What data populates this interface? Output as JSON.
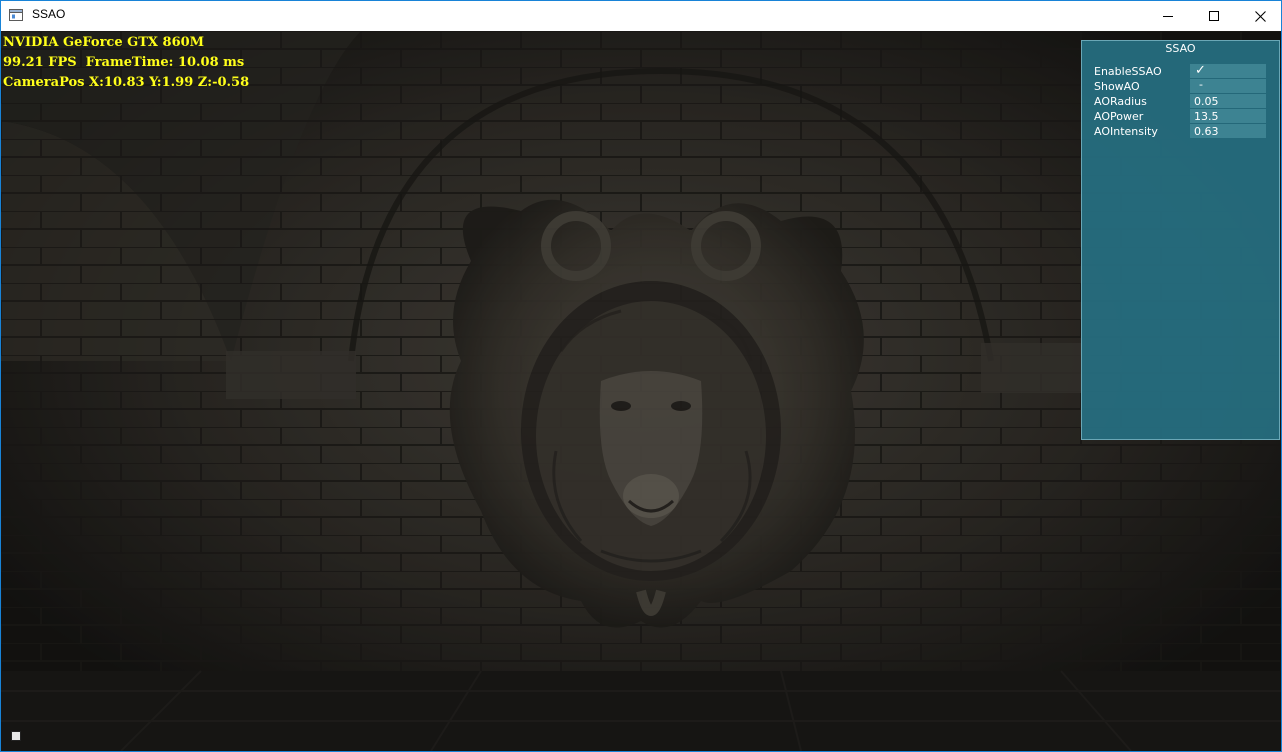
{
  "window": {
    "title": "SSAO",
    "controls": {
      "minimize_icon": "minimize-icon",
      "maximize_icon": "maximize-icon",
      "close_icon": "close-icon"
    }
  },
  "hud": {
    "gpu": "NVIDIA GeForce GTX 860M",
    "fps_line": "99.21 FPS  FrameTime: 10.08 ms",
    "camera_line": "CameraPos X:10.83 Y:1.99 Z:-0.58",
    "color": "#ffff1a"
  },
  "panel": {
    "title": "SSAO",
    "rows": [
      {
        "label": "EnableSSAO",
        "value": "✓"
      },
      {
        "label": "ShowAO",
        "value": "-"
      },
      {
        "label": "AORadius",
        "value": "0.05"
      },
      {
        "label": "AOPower",
        "value": "13.5"
      },
      {
        "label": "AOIntensity",
        "value": "0.63"
      }
    ],
    "background": "#267082"
  },
  "scene": {
    "subject": "lion head relief on stone brick wall"
  }
}
